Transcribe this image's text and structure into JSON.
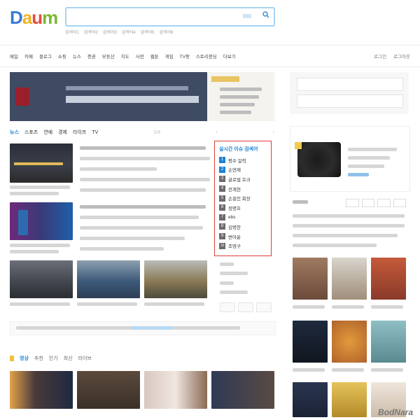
{
  "header": {
    "logo": {
      "letters": [
        "D",
        "a",
        "u",
        "m"
      ],
      "colors": [
        "#3a7bd5",
        "#f0b323",
        "#e64a3b",
        "#7bb832"
      ]
    },
    "search": {
      "placeholder": "",
      "value": ""
    },
    "suggestions": [
      "검색어1",
      "검색어2",
      "검색어3",
      "검색어4",
      "검색어5",
      "검색어6"
    ]
  },
  "gnb": {
    "items": [
      "메일",
      "카페",
      "블로그",
      "쇼핑",
      "뉴스",
      "증권",
      "부동산",
      "지도",
      "사전",
      "웹툰",
      "게임",
      "TV팟",
      "스토리펀딩",
      "더보기"
    ],
    "right": [
      "로그인",
      "로그아웃"
    ]
  },
  "banner": {
    "headline": "",
    "subline": ""
  },
  "news": {
    "tabs": [
      "뉴스",
      "스포츠",
      "연예",
      "경제",
      "라이프",
      "TV"
    ],
    "pager": "1/4"
  },
  "issue": {
    "title": "실시간 이슈 검색어",
    "items": [
      {
        "rank": "1",
        "label": "평수 일력"
      },
      {
        "rank": "2",
        "label": "손연재"
      },
      {
        "rank": "3",
        "label": "글로벌 호크"
      },
      {
        "rank": "4",
        "label": "전계현"
      },
      {
        "rank": "5",
        "label": "손흥민 회장"
      },
      {
        "rank": "6",
        "label": "정명호"
      },
      {
        "rank": "7",
        "label": "ebs"
      },
      {
        "rank": "8",
        "label": "김병찬"
      },
      {
        "rank": "9",
        "label": "변아윤"
      },
      {
        "rank": "10",
        "label": "조영구"
      }
    ]
  },
  "video": {
    "tabs": [
      "영상",
      "추천",
      "인기",
      "최신",
      "라이브"
    ]
  },
  "watermark": "BodNara",
  "colors": {
    "accent": "#1a83d6",
    "issue_border": "#d9413a",
    "rank_top": "#1a83d6",
    "rank_rest": "#6b6b6b"
  }
}
